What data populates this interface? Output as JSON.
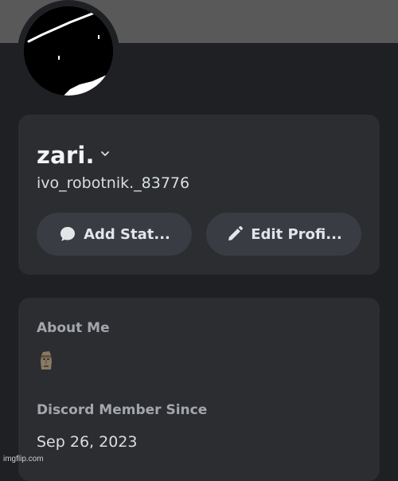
{
  "profile": {
    "display_name": "zari.",
    "username": "ivo_robotnik._83776",
    "avatar_icon": "black-scribble-avatar"
  },
  "actions": {
    "add_status_label": "Add Stat...",
    "add_status_icon": "speech-bubble-icon",
    "edit_profile_label": "Edit Profi...",
    "edit_profile_icon": "pencil-icon"
  },
  "about": {
    "title": "About Me",
    "emoji": "moai-icon"
  },
  "member_since": {
    "title": "Discord Member Since",
    "date": "Sep 26, 2023"
  },
  "watermark": "imgflip.com",
  "colors": {
    "background": "#1f2024",
    "card": "#2b2d31",
    "button": "#3a3c43",
    "banner": "#595959",
    "muted_text": "#a3a6ad"
  }
}
